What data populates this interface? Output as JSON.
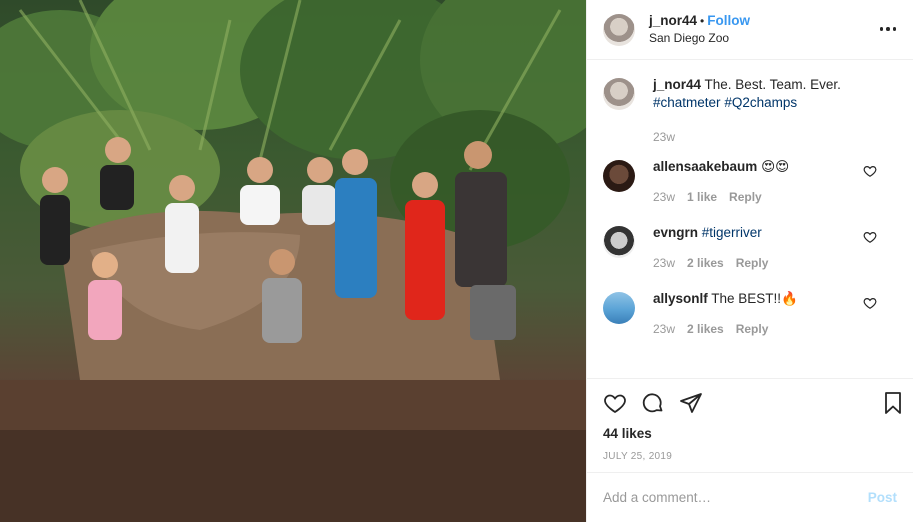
{
  "post": {
    "author": "j_nor44",
    "separator": "•",
    "follow_label": "Follow",
    "location": "San Diego Zoo",
    "photo_alt": "Group photo of a team in front of a rock sculpture at the zoo"
  },
  "caption": {
    "author": "j_nor44",
    "text": " The. Best. Team. Ever. ",
    "hashtags": [
      "#chatmeter",
      "#Q2champs"
    ],
    "age": "23w"
  },
  "comments": [
    {
      "author": "allensaakebaum",
      "text": " 😍😍",
      "age": "23w",
      "likes": "1 like",
      "reply_label": "Reply"
    },
    {
      "author": "evngrn",
      "text": " #tigerriver",
      "age": "23w",
      "likes": "2 likes",
      "reply_label": "Reply"
    },
    {
      "author": "allysonlf",
      "text": " The BEST!!🔥",
      "age": "23w",
      "likes": "2 likes",
      "reply_label": "Reply"
    }
  ],
  "stats": {
    "likes": "44 likes",
    "date": "JULY 25, 2019"
  },
  "add_comment": {
    "placeholder": "Add a comment…",
    "post_label": "Post"
  },
  "colors": {
    "link": "#3897f0",
    "hashtag": "#003569",
    "muted": "#999999",
    "post_disabled": "#b2dffc"
  },
  "icons": [
    "heart-icon",
    "comment-icon",
    "share-icon",
    "bookmark-icon",
    "more-icon",
    "small-heart-icon"
  ]
}
